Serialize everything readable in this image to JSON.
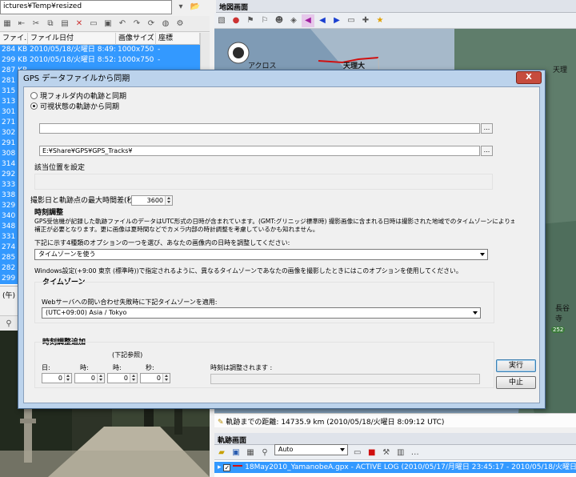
{
  "left_pane": {
    "path": "ictures¥Temp¥resized",
    "columns": [
      "ファイ...",
      "ファイル日付",
      "画像サイズ",
      "座標"
    ],
    "files": [
      {
        "size": "284 KB",
        "date": "2010/05/18/火曜日 8:49:11",
        "dim": "1000x750",
        "coord": "-"
      },
      {
        "size": "299 KB",
        "date": "2010/05/18/火曜日 8:52:36",
        "dim": "1000x750",
        "coord": "-"
      },
      {
        "size": "287 KB",
        "date": "",
        "dim": "",
        "coord": ""
      },
      {
        "size": "281 KB",
        "date": "",
        "dim": "",
        "coord": ""
      },
      {
        "size": "315 KB",
        "date": "",
        "dim": "",
        "coord": ""
      },
      {
        "size": "313 KB",
        "date": "",
        "dim": "",
        "coord": ""
      },
      {
        "size": "301 KB",
        "date": "",
        "dim": "",
        "coord": ""
      },
      {
        "size": "271 KB",
        "date": "",
        "dim": "",
        "coord": ""
      },
      {
        "size": "302 KB",
        "date": "",
        "dim": "",
        "coord": ""
      },
      {
        "size": "291 KB",
        "date": "",
        "dim": "",
        "coord": ""
      },
      {
        "size": "308 KB",
        "date": "",
        "dim": "",
        "coord": ""
      },
      {
        "size": "314 KB",
        "date": "",
        "dim": "",
        "coord": ""
      },
      {
        "size": "292 KB",
        "date": "",
        "dim": "",
        "coord": ""
      },
      {
        "size": "333 KB",
        "date": "",
        "dim": "",
        "coord": ""
      },
      {
        "size": "338 KB",
        "date": "",
        "dim": "",
        "coord": ""
      },
      {
        "size": "329 KB",
        "date": "",
        "dim": "",
        "coord": ""
      },
      {
        "size": "340 KB",
        "date": "",
        "dim": "",
        "coord": ""
      },
      {
        "size": "348 KB",
        "date": "",
        "dim": "",
        "coord": ""
      },
      {
        "size": "331 KB",
        "date": "",
        "dim": "",
        "coord": ""
      },
      {
        "size": "274 KB",
        "date": "",
        "dim": "",
        "coord": ""
      },
      {
        "size": "285 KB",
        "date": "",
        "dim": "",
        "coord": ""
      },
      {
        "size": "282 KB",
        "date": "",
        "dim": "",
        "coord": ""
      },
      {
        "size": "299 KB",
        "date": "",
        "dim": "",
        "coord": ""
      }
    ],
    "status": "(午) - 90"
  },
  "map": {
    "title": "地図画面",
    "places": [
      "アクロス",
      "天理大",
      "天理",
      "長谷寺",
      "252"
    ],
    "distance": "軌跡までの距離: 14735.9 km (2010/05/18/火曜日 8:09:12 UTC)"
  },
  "track": {
    "title": "軌跡画面",
    "combo_value": "Auto",
    "row": "18May2010_YamanobeA.gpx - ACTIVE LOG (2010/05/17/月曜日 23:45:17 - 2010/05/18/火曜日 8:09:17, 1663 地点, 2"
  },
  "dialog": {
    "title": "GPS データファイルから同期",
    "close_label": "X",
    "radio_folder": "現フォルダ内の軌跡と同期",
    "radio_visible": "可視状態の軌跡から同期",
    "file_path": "",
    "folder_path": "E:¥Share¥GPS¥GPS_Tracks¥",
    "browse": "...",
    "location_group": "該当位置を設定",
    "max_diff_label": "撮影日と軌跡点の最大時間差(秒):",
    "max_diff_value": "3600",
    "time_adjust_title": "時刻調整",
    "time_adjust_desc1": "GPS受信機が記録した軌跡ファイルのデータはUTC形式の日時が含まれています。(GMT:グリニッジ標準時) 撮影画像に含まれる日時は撮影された地域でのタイムゾーンにより±",
    "time_adjust_desc2": "補正が必要となります。更に画像は夏時間などでカメラ内部の時計調整を考慮しているかも知れません。",
    "option_prompt": "下記に示す4種類のオプションの一つを選び、あなたの画像内の日時を調整してください:",
    "option_value": "タイムゾーンを使う",
    "windows_note": "Windows設定(+9:00 東京 (標準時))で指定されるように、異なるタイムゾーンであなたの画像を撮影したときにはこのオプションを使用してください。",
    "tz_title": "タイムゾーン",
    "tz_label": "Webサーバへの問い合わせ失敗時に下記タイムゾーンを適用:",
    "tz_value": "(UTC+09:00) Asia / Tokyo",
    "extra_title": "時刻調整追加",
    "extra_note": "(下記参照)",
    "day_label": "日:",
    "hour_label": "時:",
    "minute_label": "時:",
    "second_label": "秒:",
    "day_value": "0",
    "hour_value": "0",
    "minute_value": "0",
    "second_value": "0",
    "adjusted_label": "時刻は調整されます :",
    "run_button": "実行",
    "cancel_button": "中止"
  },
  "colors": {
    "selection": "#3399ff",
    "dialog_frame": "#bcd3ec",
    "close_red": "#c64b3d"
  }
}
